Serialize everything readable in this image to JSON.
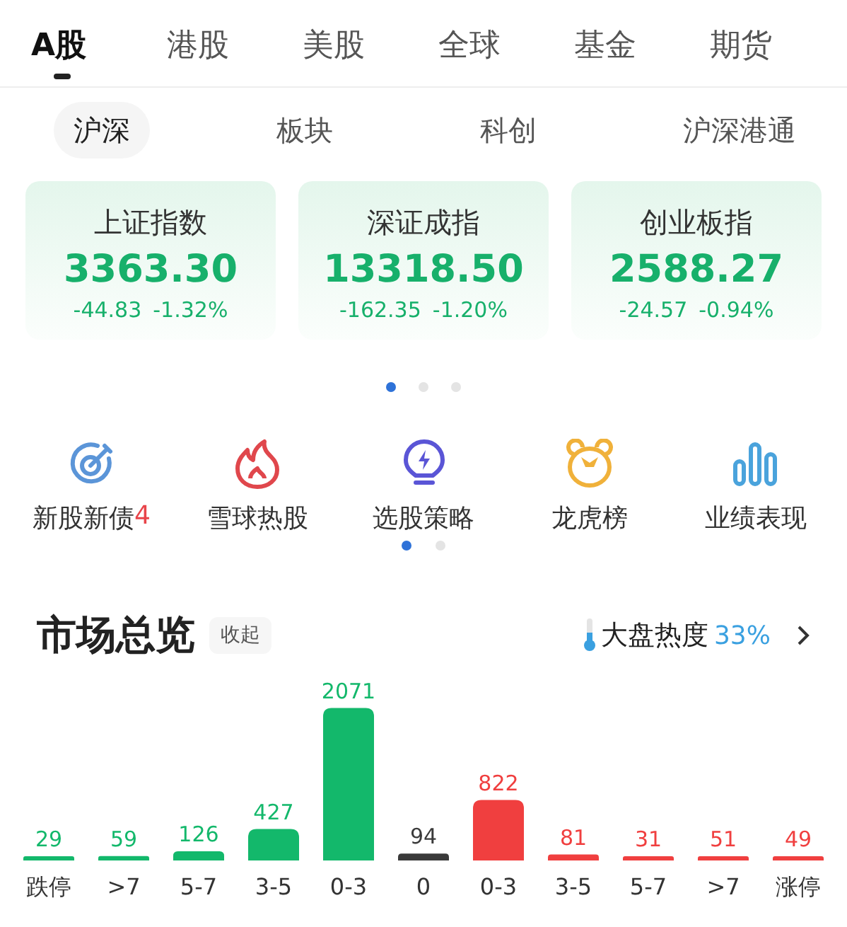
{
  "tabs": [
    {
      "label": "A股",
      "selected": true
    },
    {
      "label": "港股",
      "selected": false
    },
    {
      "label": "美股",
      "selected": false
    },
    {
      "label": "全球",
      "selected": false
    },
    {
      "label": "基金",
      "selected": false
    },
    {
      "label": "期货",
      "selected": false
    }
  ],
  "sub_tabs": [
    {
      "label": "沪深",
      "selected": true
    },
    {
      "label": "板块",
      "selected": false
    },
    {
      "label": "科创",
      "selected": false
    },
    {
      "label": "沪深港通",
      "selected": false
    }
  ],
  "index_cards": [
    {
      "name": "上证指数",
      "value": "3363.30",
      "change": "-44.83",
      "percent": "-1.32%"
    },
    {
      "name": "深证成指",
      "value": "13318.50",
      "change": "-162.35",
      "percent": "-1.20%"
    },
    {
      "name": "创业板指",
      "value": "2588.27",
      "change": "-24.57",
      "percent": "-0.94%"
    }
  ],
  "card_pager": [
    {
      "selected": true
    },
    {
      "selected": false
    },
    {
      "selected": false
    }
  ],
  "shortcuts": [
    {
      "kind": "target",
      "label": "新股新债",
      "badge": "4"
    },
    {
      "kind": "flame",
      "label": "雪球热股"
    },
    {
      "kind": "bulb",
      "label": "选股策略"
    },
    {
      "kind": "bear",
      "label": "龙虎榜"
    },
    {
      "kind": "bars",
      "label": "业绩表现"
    }
  ],
  "shortcut_pager": [
    {
      "selected": true
    },
    {
      "selected": false
    }
  ],
  "market_overview": {
    "title": "市场总览",
    "collapse_button": "收起",
    "heat_label": "大盘热度",
    "heat_value": "33%",
    "chart_data": {
      "type": "bar",
      "categories": [
        "跌停",
        ">7",
        "5-7",
        "3-5",
        "0-3",
        "0",
        "0-3",
        "3-5",
        "5-7",
        ">7",
        "涨停"
      ],
      "data_labels": true,
      "series": [
        {
          "color": "#13b86b",
          "values": [
            29,
            59,
            126,
            427,
            2071,
            null,
            null,
            null,
            null,
            null,
            null
          ]
        },
        {
          "color": "#3a3a3a",
          "values": [
            null,
            null,
            null,
            null,
            null,
            94,
            null,
            null,
            null,
            null,
            null
          ]
        },
        {
          "color": "#f03f3f",
          "values": [
            null,
            null,
            null,
            null,
            null,
            null,
            822,
            81,
            31,
            51,
            49
          ]
        }
      ]
    }
  }
}
